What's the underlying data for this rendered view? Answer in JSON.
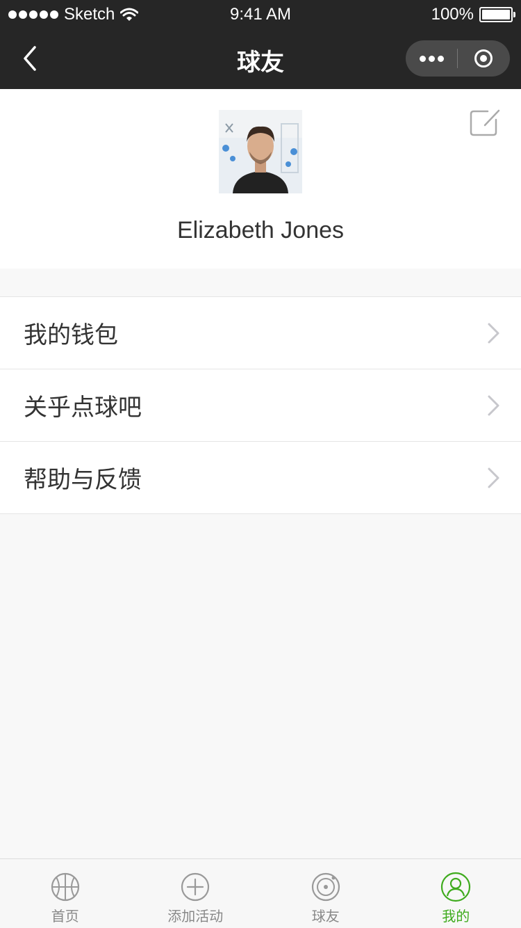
{
  "status_bar": {
    "carrier": "Sketch",
    "time": "9:41 AM",
    "battery": "100%"
  },
  "nav": {
    "title": "球友"
  },
  "profile": {
    "name": "Elizabeth Jones"
  },
  "menu": {
    "items": [
      {
        "label": "我的钱包"
      },
      {
        "label": "关乎点球吧"
      },
      {
        "label": "帮助与反馈"
      }
    ]
  },
  "tabbar": {
    "items": [
      {
        "label": "首页",
        "icon": "basketball-icon"
      },
      {
        "label": "添加活动",
        "icon": "add-circle-icon"
      },
      {
        "label": "球友",
        "icon": "target-icon"
      },
      {
        "label": "我的",
        "icon": "user-icon",
        "active": true
      }
    ]
  },
  "colors": {
    "nav_bg": "#262626",
    "accent_green": "#3fab1e",
    "page_bg": "#f8f8f8"
  }
}
